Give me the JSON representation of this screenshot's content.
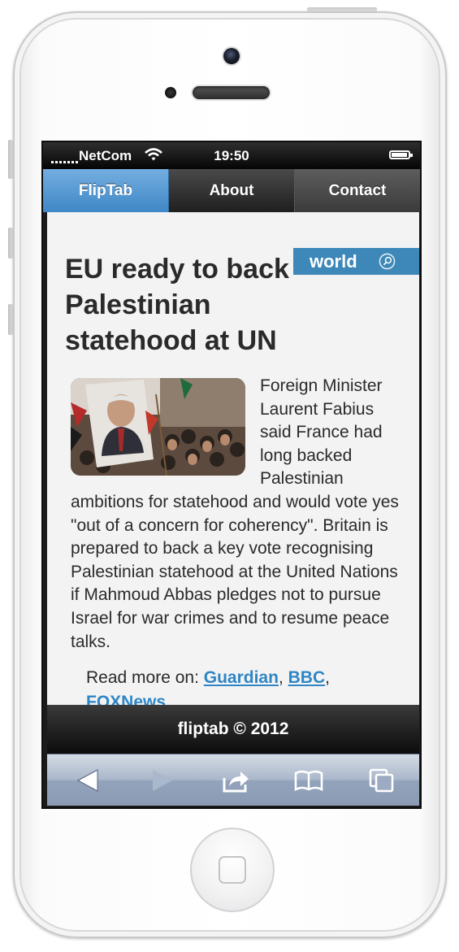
{
  "status_bar": {
    "carrier": "NetCom",
    "time": "19:50"
  },
  "tabs": [
    {
      "label": "FlipTab",
      "active": true
    },
    {
      "label": "About",
      "active": false
    },
    {
      "label": "Contact",
      "active": false
    }
  ],
  "category_badge": {
    "label": "world",
    "icon": "search-icon",
    "color": "#3d88b8"
  },
  "article": {
    "headline": "EU ready to back Palestinian statehood at UN",
    "body": "Foreign Minister Laurent Fabius said France had long backed Palestinian ambitions for statehood and would vote yes \"out of a concern for coherency\". Britain is prepared to back a key vote recognising Palestinian statehood at the United Nations if Mahmoud Abbas pledges not to pursue Israel for war crimes and to resume peace talks.",
    "image_icon": "news-photo",
    "read_more_prefix": "Read more on: ",
    "sources": [
      "Guardian",
      "BBC",
      "FOXNews"
    ],
    "separator": ", "
  },
  "footer": {
    "text": "fliptab © 2012"
  },
  "browser_toolbar": {
    "icons": [
      "back-arrow-icon",
      "forward-arrow-icon",
      "share-icon",
      "bookmarks-icon",
      "pages-icon"
    ]
  },
  "colors": {
    "accent": "#4a90d0",
    "link": "#2f86c6",
    "active_tab": "#5a9ed6"
  }
}
